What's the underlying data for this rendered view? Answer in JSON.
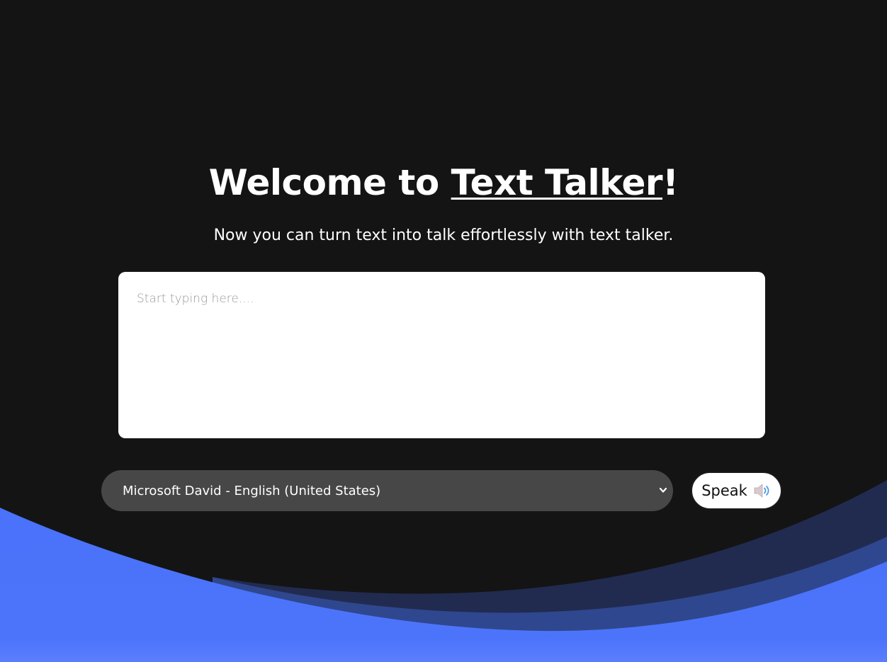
{
  "header": {
    "title_prefix": "Welcome to ",
    "title_brand": "Text Talker",
    "title_suffix": "!",
    "subtitle": "Now you can turn text into talk effortlessly with text talker."
  },
  "editor": {
    "placeholder": "Start typing here....",
    "value": ""
  },
  "voice": {
    "selected": "Microsoft David - English (United States)"
  },
  "speak_button": {
    "label": "Speak",
    "icon": "speaker-icon"
  },
  "colors": {
    "background": "#141414",
    "wave_front": "#4c74fb",
    "wave_mid": "#2f478e",
    "wave_back": "#212b50",
    "select_bg": "#474747"
  }
}
